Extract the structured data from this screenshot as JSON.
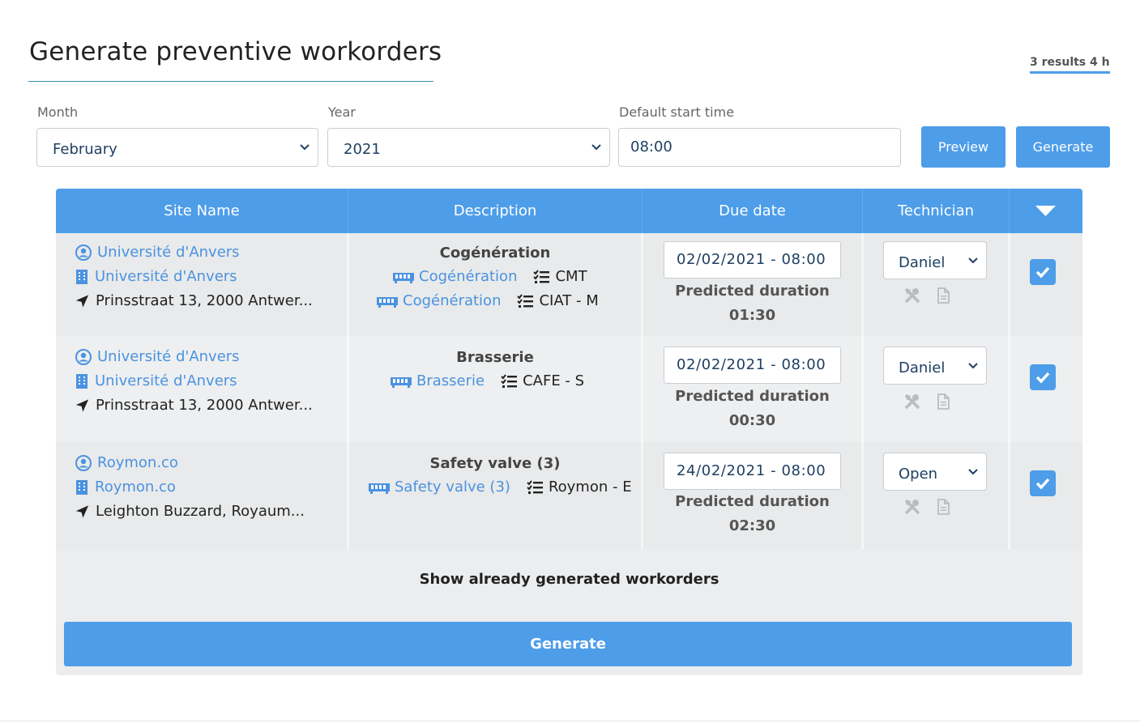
{
  "page": {
    "title": "Generate preventive workorders",
    "results": "3 results 4 h"
  },
  "filters": {
    "month_label": "Month",
    "month_value": "February",
    "year_label": "Year",
    "year_value": "2021",
    "start_time_label": "Default start time",
    "start_time_value": "08:00",
    "preview_label": "Preview",
    "generate_label": "Generate"
  },
  "table": {
    "headers": [
      "Site Name",
      "Description",
      "Due date",
      "Technician"
    ],
    "rows": [
      {
        "site_user": "Université d'Anvers",
        "site_building": "Université d'Anvers",
        "address": "Prinsstraat 13, 2000 Antwer...",
        "desc_title": "Cogénération",
        "desc_items": [
          {
            "asset": "Cogénération",
            "task": "CMT"
          },
          {
            "asset": "Cogénération",
            "task": "CIAT - M"
          }
        ],
        "due_date": "02/02/2021 - 08:00",
        "predicted_label": "Predicted duration",
        "predicted_value": "01:30",
        "technician": "Daniel",
        "checked": true
      },
      {
        "site_user": "Université d'Anvers",
        "site_building": "Université d'Anvers",
        "address": "Prinsstraat 13, 2000 Antwer...",
        "desc_title": "Brasserie",
        "desc_items": [
          {
            "asset": "Brasserie",
            "task": "CAFE - S"
          }
        ],
        "due_date": "02/02/2021 - 08:00",
        "predicted_label": "Predicted duration",
        "predicted_value": "00:30",
        "technician": "Daniel",
        "checked": true
      },
      {
        "site_user": "Roymon.co",
        "site_building": "Roymon.co",
        "address": "Leighton Buzzard, Royaum...",
        "desc_title": "Safety valve (3)",
        "desc_items": [
          {
            "asset": "Safety valve (3)",
            "task": "Roymon - E"
          }
        ],
        "due_date": "24/02/2021 - 08:00",
        "predicted_label": "Predicted duration",
        "predicted_value": "02:30",
        "technician": "Open",
        "checked": true
      }
    ]
  },
  "show_generated_label": "Show already generated workorders",
  "generate_button_label": "Generate",
  "colors": {
    "accent": "#4d9de9",
    "link": "#4a93e0",
    "row_bg": "#ebedef"
  }
}
